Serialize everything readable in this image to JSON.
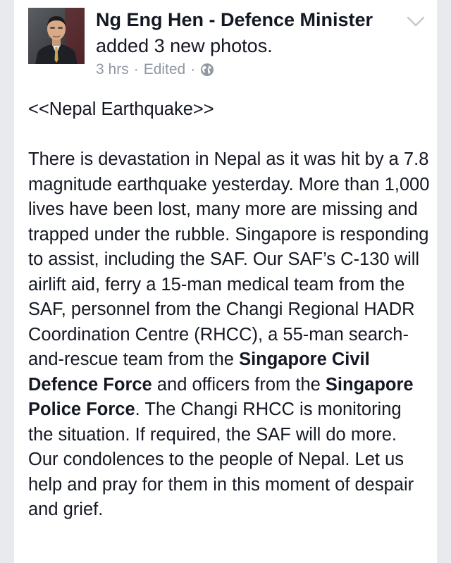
{
  "post": {
    "author": "Ng Eng Hen - Defence Minister",
    "action": "added 3 new photos.",
    "timestamp": "3 hrs",
    "edited": "Edited",
    "separator": "·",
    "privacy_icon": "globe-icon",
    "options_icon": "chevron-down-icon",
    "avatar_icon": "profile-photo",
    "heading": "<<Nepal Earthquake>>",
    "body": {
      "part1": "There is devastation in Nepal as it was hit by a 7.8 magnitude earthquake yesterday. More than 1,000 lives have been lost, many more are missing and trapped under the rubble. Singapore is responding to assist, including the SAF. Our SAF’s C-130 will airlift aid, ferry a 15-man medical team from the SAF, personnel from the Changi Regional HADR Coordination Centre (RHCC), a 55-man search-and-rescue team from the ",
      "mention1": "Singapore Civil Defence Force",
      "part2": " and officers from the ",
      "mention2": "Singapore Police Force",
      "part3": ". The Changi RHCC is monitoring the situation. If required, the SAF will do more. Our condolences to the people of Nepal. Let us help and pray for them in this moment of despair and grief."
    }
  },
  "colors": {
    "background": "#e9eaed",
    "card": "#ffffff",
    "text": "#141823",
    "meta": "#9197a3"
  }
}
